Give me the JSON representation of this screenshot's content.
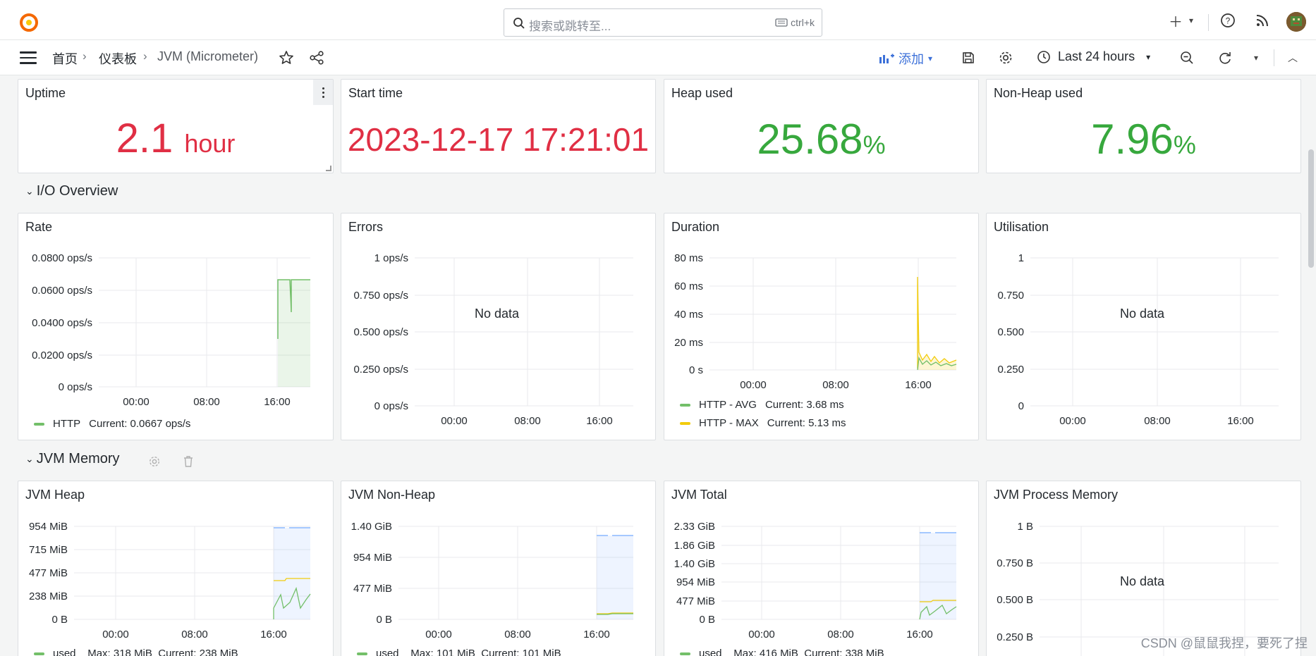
{
  "topbar": {
    "search_placeholder": "搜索或跳转至...",
    "search_shortcut": "ctrl+k"
  },
  "navbar": {
    "breadcrumbs": [
      "首页",
      "仪表板",
      "JVM (Micrometer)"
    ],
    "add_label": "添加",
    "time_range": "Last 24 hours"
  },
  "stats": {
    "uptime": {
      "title": "Uptime",
      "value": "2.1",
      "unit": "hour",
      "color": "#e02f44"
    },
    "start_time": {
      "title": "Start time",
      "value": "2023-12-17 17:21:01",
      "color": "#e02f44"
    },
    "heap_used": {
      "title": "Heap used",
      "value": "25.68",
      "unit": "%",
      "color": "#37a83d"
    },
    "nonheap_used": {
      "title": "Non-Heap used",
      "value": "7.96",
      "unit": "%",
      "color": "#37a83d"
    }
  },
  "rows": {
    "io": "I/O Overview",
    "jvm_memory": "JVM Memory"
  },
  "panels": {
    "rate": {
      "title": "Rate",
      "yticks": [
        "0.0800 ops/s",
        "0.0600 ops/s",
        "0.0400 ops/s",
        "0.0200 ops/s",
        "0 ops/s"
      ],
      "xticks": [
        "00:00",
        "08:00",
        "16:00"
      ],
      "legend": [
        {
          "name": "HTTP",
          "current": "Current: 0.0667 ops/s",
          "color": "#73bf69"
        }
      ]
    },
    "errors": {
      "title": "Errors",
      "yticks": [
        "1 ops/s",
        "0.750 ops/s",
        "0.500 ops/s",
        "0.250 ops/s",
        "0 ops/s"
      ],
      "xticks": [
        "00:00",
        "08:00",
        "16:00"
      ],
      "nodata": "No data"
    },
    "duration": {
      "title": "Duration",
      "yticks": [
        "80 ms",
        "60 ms",
        "40 ms",
        "20 ms",
        "0 s"
      ],
      "xticks": [
        "00:00",
        "08:00",
        "16:00"
      ],
      "legend": [
        {
          "name": "HTTP - AVG",
          "current": "Current: 3.68 ms",
          "color": "#73bf69"
        },
        {
          "name": "HTTP - MAX",
          "current": "Current: 5.13 ms",
          "color": "#f2cc0c"
        }
      ]
    },
    "utilisation": {
      "title": "Utilisation",
      "yticks": [
        "1",
        "0.750",
        "0.500",
        "0.250",
        "0"
      ],
      "xticks": [
        "00:00",
        "08:00",
        "16:00"
      ],
      "nodata": "No data"
    },
    "jvm_heap": {
      "title": "JVM Heap",
      "yticks": [
        "954 MiB",
        "715 MiB",
        "477 MiB",
        "238 MiB",
        "0 B"
      ],
      "xticks": [
        "00:00",
        "08:00",
        "16:00"
      ],
      "legend_partial": "used    Max: 318 MiB  Current: 238 MiB"
    },
    "jvm_nonheap": {
      "title": "JVM Non-Heap",
      "yticks": [
        "1.40 GiB",
        "954 MiB",
        "477 MiB",
        "0 B"
      ],
      "xticks": [
        "00:00",
        "08:00",
        "16:00"
      ],
      "legend_partial": "used    Max: 101 MiB  Current: 101 MiB"
    },
    "jvm_total": {
      "title": "JVM Total",
      "yticks": [
        "2.33 GiB",
        "1.86 GiB",
        "1.40 GiB",
        "954 MiB",
        "477 MiB",
        "0 B"
      ],
      "xticks": [
        "00:00",
        "08:00",
        "16:00"
      ],
      "legend_partial": "used    Max: 416 MiB  Current: 338 MiB"
    },
    "jvm_process": {
      "title": "JVM Process Memory",
      "yticks": [
        "1 B",
        "0.750 B",
        "0.500 B",
        "0.250 B"
      ],
      "nodata": "No data"
    }
  },
  "watermark": "CSDN @鼠鼠我捏，要死了捏"
}
